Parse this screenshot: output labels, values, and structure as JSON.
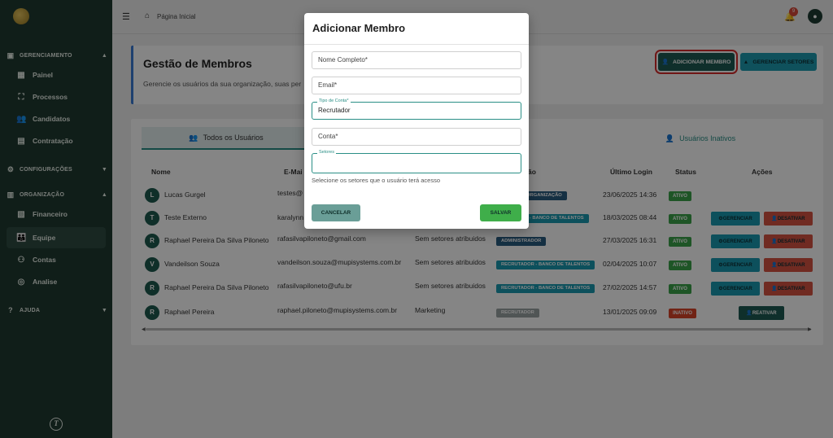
{
  "sidebar": {
    "sections": [
      {
        "label": "GERENCIAMENTO",
        "icon": "briefcase-icon"
      },
      {
        "label": "CONFIGURAÇÕES",
        "icon": "gear-icon"
      },
      {
        "label": "ORGANIZAÇÃO",
        "icon": "building-icon"
      },
      {
        "label": "AJUDA",
        "icon": "help-icon"
      }
    ],
    "items": [
      {
        "label": "Painel",
        "icon": "dashboard-icon"
      },
      {
        "label": "Processos",
        "icon": "process-icon"
      },
      {
        "label": "Candidatos",
        "icon": "people-icon"
      },
      {
        "label": "Contratação",
        "icon": "document-icon"
      },
      {
        "label": "Financeiro",
        "icon": "finance-icon"
      },
      {
        "label": "Equipe",
        "icon": "team-icon"
      },
      {
        "label": "Contas",
        "icon": "accounts-icon"
      },
      {
        "label": "Analise",
        "icon": "analysis-icon"
      }
    ],
    "active_item": "Equipe",
    "footer_logo": "T"
  },
  "topbar": {
    "breadcrumb": "Página Inicial",
    "notification_count": "9"
  },
  "header": {
    "title": "Gestão de Membros",
    "subtitle": "Gerencie os usuários da sua organização, suas per",
    "add_member": "ADICIONAR MEMBRO",
    "manage_sectors": "GERENCIAR SETORES"
  },
  "tabs": {
    "all_users": "Todos os Usuários",
    "inactive_users": "Usuários Inativos"
  },
  "table": {
    "headers": {
      "name": "Nome",
      "email": "E-Mai",
      "sectors": "ão",
      "last_login": "Último Login",
      "status": "Status",
      "actions": "Ações"
    },
    "rows": [
      {
        "initial": "L",
        "name": "Lucas Gurgel",
        "email": "testes@",
        "sectors": "",
        "role": "ORGANIZAÇÃO",
        "last_login": "23/06/2025 14:36",
        "status": "ATIVO"
      },
      {
        "initial": "T",
        "name": "Teste Externo",
        "email": "karalynn",
        "sectors": "",
        "role": "R - BANCO DE TALENTOS",
        "last_login": "18/03/2025 08:44",
        "status": "ATIVO"
      },
      {
        "initial": "R",
        "name": "Raphael Pereira Da Silva Piloneto",
        "email": "rafasilvapiloneto@gmail.com",
        "sectors": "Sem setores atribuidos",
        "role": "ADMINISTRADOR",
        "last_login": "27/03/2025 16:31",
        "status": "ATIVO"
      },
      {
        "initial": "V",
        "name": "Vandeilson Souza",
        "email": "vandeilson.souza@mupisystems.com.br",
        "sectors": "Sem setores atribuidos",
        "role": "RECRUTADOR - BANCO DE TALENTOS",
        "last_login": "02/04/2025 10:07",
        "status": "ATIVO"
      },
      {
        "initial": "R",
        "name": "Raphael Pereira Da Silva Piloneto",
        "email": "rafasilvapiloneto@ufu.br",
        "sectors": "Sem setores atribuidos",
        "role": "RECRUTADOR - BANCO DE TALENTOS",
        "last_login": "27/02/2025 14:57",
        "status": "ATIVO"
      },
      {
        "initial": "R",
        "name": "Raphael Pereira",
        "email": "raphael.piloneto@mupisystems.com.br",
        "sectors": "Marketing",
        "role": "RECRUTADOR",
        "last_login": "13/01/2025 09:09",
        "status": "INATIVO"
      }
    ],
    "action_manage": "GERENCIAR",
    "action_deactivate": "DESATIVAR",
    "action_reactivate": "REATIVAR"
  },
  "modal": {
    "title": "Adicionar Membro",
    "full_name_placeholder": "Nome Completo*",
    "email_placeholder": "Email*",
    "account_type_label": "Tipo de Conta*",
    "account_type_value": "Recrutador",
    "account_placeholder": "Conta*",
    "sectors_label": "Setores",
    "sectors_helper": "Selecione os setores que o usuário terá acesso",
    "cancel": "CANCELAR",
    "save": "SALVAR"
  }
}
